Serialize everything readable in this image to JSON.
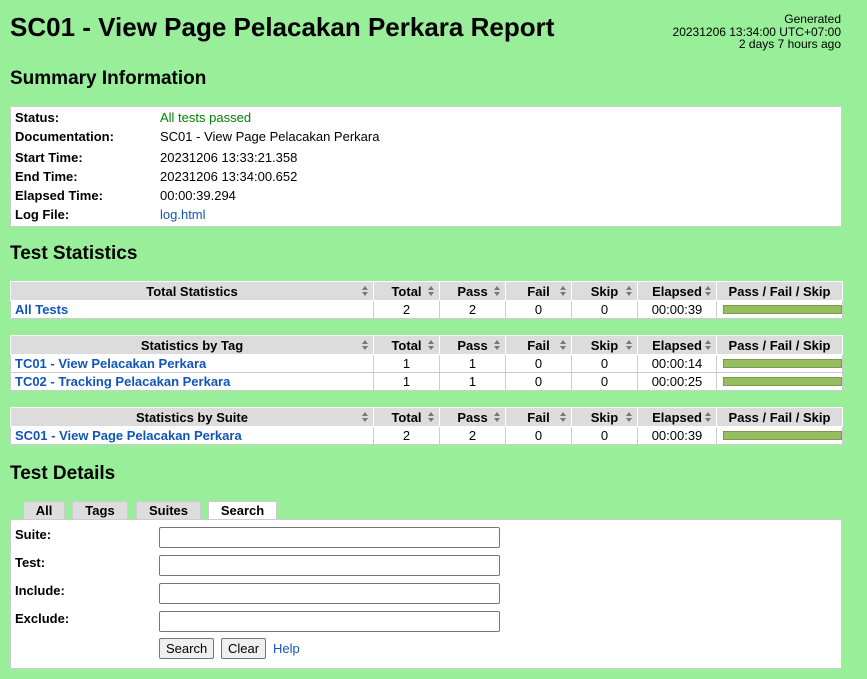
{
  "header": {
    "title": "SC01 - View Page Pelacakan Perkara Report",
    "generated_label": "Generated",
    "generated_time": "20231206 13:34:00 UTC+07:00",
    "generated_ago": "2 days 7 hours ago"
  },
  "summary": {
    "heading": "Summary Information",
    "rows": [
      {
        "label": "Status:",
        "value": "All tests passed"
      },
      {
        "label": "Documentation:",
        "value": "SC01 - View Page Pelacakan Perkara"
      },
      {
        "label": "Start Time:",
        "value": "20231206 13:33:21.358"
      },
      {
        "label": "End Time:",
        "value": "20231206 13:34:00.652"
      },
      {
        "label": "Elapsed Time:",
        "value": "00:00:39.294"
      },
      {
        "label": "Log File:",
        "value": "log.html"
      }
    ]
  },
  "statistics": {
    "heading": "Test Statistics",
    "columns": [
      "Total",
      "Pass",
      "Fail",
      "Skip",
      "Elapsed",
      "Pass / Fail / Skip"
    ],
    "total": {
      "header": "Total Statistics",
      "rows": [
        {
          "name": "All Tests",
          "total": "2",
          "pass": "2",
          "fail": "0",
          "skip": "0",
          "elapsed": "00:00:39",
          "pass_ratio": 1.0
        }
      ]
    },
    "tag": {
      "header": "Statistics by Tag",
      "rows": [
        {
          "name": "TC01 - View Pelacakan Perkara",
          "total": "1",
          "pass": "1",
          "fail": "0",
          "skip": "0",
          "elapsed": "00:00:14",
          "pass_ratio": 1.0
        },
        {
          "name": "TC02 - Tracking Pelacakan Perkara",
          "total": "1",
          "pass": "1",
          "fail": "0",
          "skip": "0",
          "elapsed": "00:00:25",
          "pass_ratio": 1.0
        }
      ]
    },
    "suite": {
      "header": "Statistics by Suite",
      "rows": [
        {
          "name": "SC01 - View Page Pelacakan Perkara",
          "total": "2",
          "pass": "2",
          "fail": "0",
          "skip": "0",
          "elapsed": "00:00:39",
          "pass_ratio": 1.0
        }
      ]
    }
  },
  "details": {
    "heading": "Test Details",
    "tabs": [
      "All",
      "Tags",
      "Suites",
      "Search"
    ],
    "active_tab": "Search",
    "form": {
      "suite_label": "Suite:",
      "test_label": "Test:",
      "include_label": "Include:",
      "exclude_label": "Exclude:",
      "suite_value": "",
      "test_value": "",
      "include_value": "",
      "exclude_value": "",
      "search_button": "Search",
      "clear_button": "Clear",
      "help_link": "Help"
    }
  },
  "colors": {
    "background": "#99ee99",
    "pass": "#008000",
    "link": "#1155bb",
    "graph_pass": "#97bd61"
  }
}
